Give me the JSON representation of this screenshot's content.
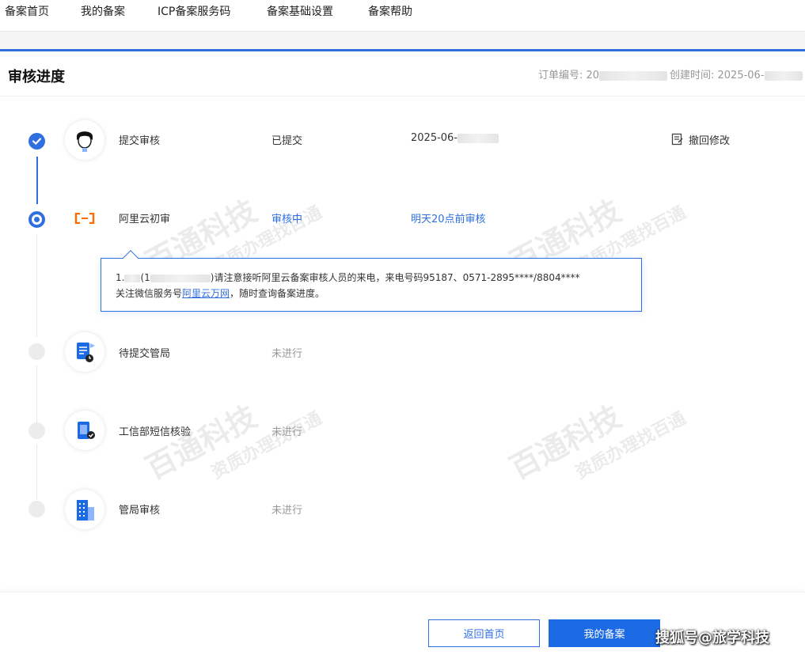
{
  "nav": {
    "items": [
      {
        "label": "备案首页"
      },
      {
        "label": "我的备案"
      },
      {
        "label": "ICP备案服务码"
      },
      {
        "label": "备案基础设置"
      },
      {
        "label": "备案帮助"
      }
    ]
  },
  "header": {
    "title": "审核进度",
    "order_label": "订单编号: 20",
    "created_label": "创建时间: 2025-06-"
  },
  "steps": [
    {
      "name": "提交审核",
      "status": "已提交",
      "time": "2025-06-",
      "icon": "person-avatar-icon"
    },
    {
      "name": "阿里云初审",
      "status": "审核中",
      "time": "明天20点前审核",
      "icon": "aliyun-logo-icon"
    },
    {
      "name": "待提交管局",
      "status": "未进行",
      "time": "",
      "icon": "document-clock-icon"
    },
    {
      "name": "工信部短信核验",
      "status": "未进行",
      "time": "",
      "icon": "phone-check-icon"
    },
    {
      "name": "管局审核",
      "status": "未进行",
      "time": "",
      "icon": "building-icon"
    }
  ],
  "withdraw": {
    "label": "撤回修改",
    "icon": "withdraw-edit-icon"
  },
  "notice": {
    "line1_prefix": "1.",
    "line1_mid": "(1",
    "line1_rest": ")请注意接听阿里云备案审核人员的来电，来电号码95187、0571-2895****/8804****",
    "line2_before": "关注微信服务号",
    "line2_link": "阿里云万网",
    "line2_after": "，随时查询备案进度。"
  },
  "footer": {
    "back_label": "返回首页",
    "my_label": "我的备案"
  },
  "overlay": {
    "sohu_text": "搜狐号@旅学科技"
  },
  "watermark": {
    "main": "百通科技",
    "sub": "资质办理找百通"
  },
  "colors": {
    "accent": "#2f6fe0",
    "primary_button": "#1c6ae4",
    "pending": "#999999"
  }
}
